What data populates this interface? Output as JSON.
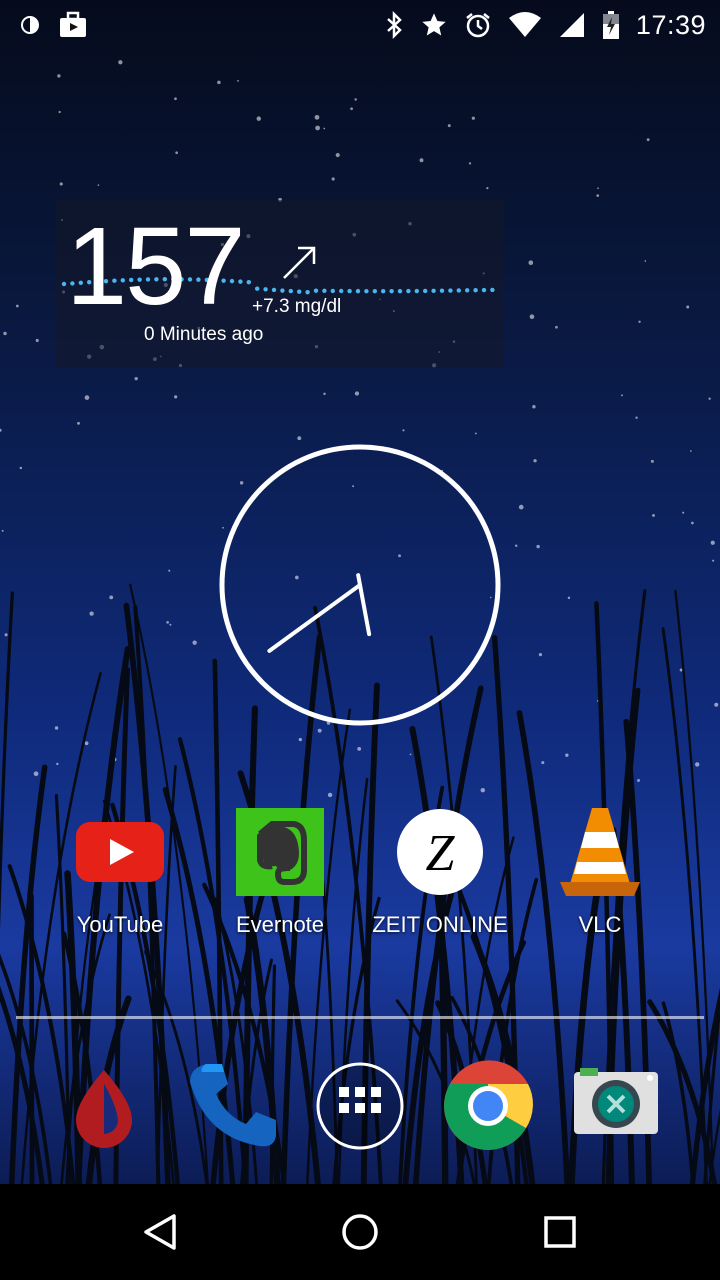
{
  "status_bar": {
    "time": "17:39",
    "left_icons": [
      "drip-notification-icon",
      "briefcase-notification-icon"
    ],
    "right_icons": [
      "bluetooth-icon",
      "star-icon",
      "alarm-icon",
      "wifi-icon",
      "signal-icon",
      "battery-charging-icon"
    ]
  },
  "glucose_widget": {
    "value": "157",
    "delta": "+7.3 mg/dl",
    "age": "0 Minutes ago",
    "trend": "rising",
    "dot_color": "#4ab6f0"
  },
  "clock_widget": {
    "hour": 5,
    "minute": 39,
    "color": "#ffffff"
  },
  "apps": [
    {
      "label": "YouTube",
      "icon": "youtube-icon"
    },
    {
      "label": "Evernote",
      "icon": "evernote-icon"
    },
    {
      "label": "ZEIT ONLINE",
      "icon": "zeit-online-icon"
    },
    {
      "label": "VLC",
      "icon": "vlc-icon"
    }
  ],
  "dock": [
    {
      "icon": "blood-drop-app-icon"
    },
    {
      "icon": "phone-icon"
    },
    {
      "icon": "app-drawer-icon"
    },
    {
      "icon": "chrome-icon"
    },
    {
      "icon": "camera-icon"
    }
  ],
  "nav_bar": {
    "buttons": [
      "back-icon",
      "home-icon",
      "recents-icon"
    ]
  }
}
